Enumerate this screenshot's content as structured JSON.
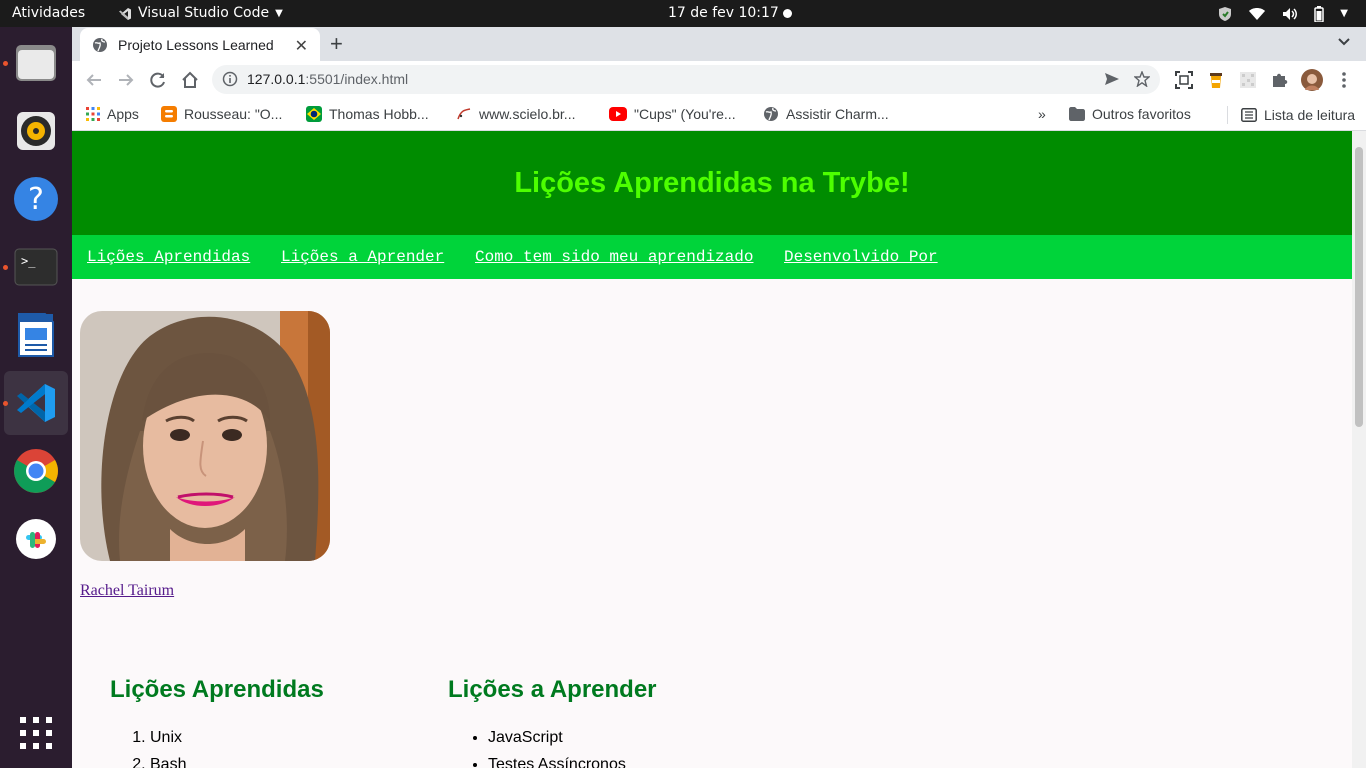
{
  "topbar": {
    "activities": "Atividades",
    "app_name": "Visual Studio Code",
    "clock": "17 de fev  10:17"
  },
  "dock": {
    "items": [
      "files-icon",
      "rhythmbox-icon",
      "help-icon",
      "terminal-icon",
      "writer-icon",
      "vscode-icon",
      "chrome-icon",
      "slack-icon",
      "app-grid-icon"
    ]
  },
  "browser": {
    "tab_title": "Projeto Lessons Learned",
    "url_host": "127.0.0.1",
    "url_rest": ":5501/index.html",
    "bookmarks": [
      "Apps",
      "Rousseau: \"O...",
      "Thomas Hobb...",
      "www.scielo.br...",
      "\"Cups\" (You're...",
      "Assistir Charm..."
    ],
    "more_bookmarks": "»",
    "other_favorites": "Outros favoritos",
    "reading_list": "Lista de leitura"
  },
  "page": {
    "title": "Lições Aprendidas na Trybe!",
    "nav": [
      "Lições Aprendidas",
      "Lições a Aprender",
      "Como tem sido meu aprendizado",
      "Desenvolvido Por"
    ],
    "author": "Rachel Tairum",
    "learned": {
      "title": "Lições Aprendidas",
      "items": [
        "Unix",
        "Bash"
      ]
    },
    "to_learn": {
      "title": "Lições a Aprender",
      "items": [
        "JavaScript",
        "Testes Assíncronos"
      ]
    }
  },
  "colors": {
    "header_bg": "#008c00",
    "header_text": "#4dff00",
    "nav_bg": "#00d43a",
    "section_title": "#007a1f"
  }
}
